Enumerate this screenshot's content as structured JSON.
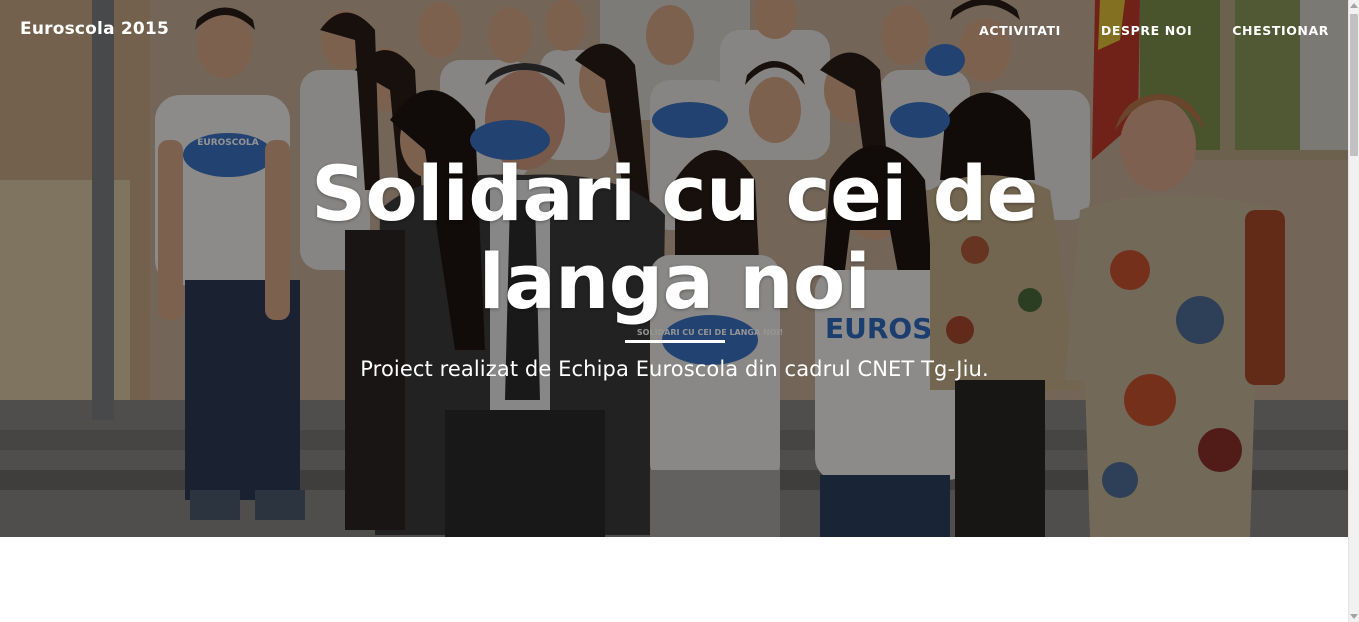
{
  "navbar": {
    "brand": "Euroscola 2015",
    "links": [
      {
        "label": "ACTIVITATI"
      },
      {
        "label": "DESPRE NOI"
      },
      {
        "label": "CHESTIONAR"
      }
    ]
  },
  "hero": {
    "title": "Solidari cu cei de langa noi",
    "subtitle": "Proiect realizat de Echipa Euroscola din cadrul CNET Tg-Jiu.",
    "photo": "group-photo-students-and-teachers",
    "tshirt_print_top": "EUROSCOLA",
    "tshirt_print_main": "SOLIDARI CU CEI DE LANGA NOI!",
    "tshirt_print_front": "EUROSCO"
  },
  "colors": {
    "hero_text": "#ffffff",
    "overlay": "rgba(0,0,0,0.42)",
    "page_background": "#ffffff",
    "tshirt_logo_blue": "#2f6cc0"
  }
}
